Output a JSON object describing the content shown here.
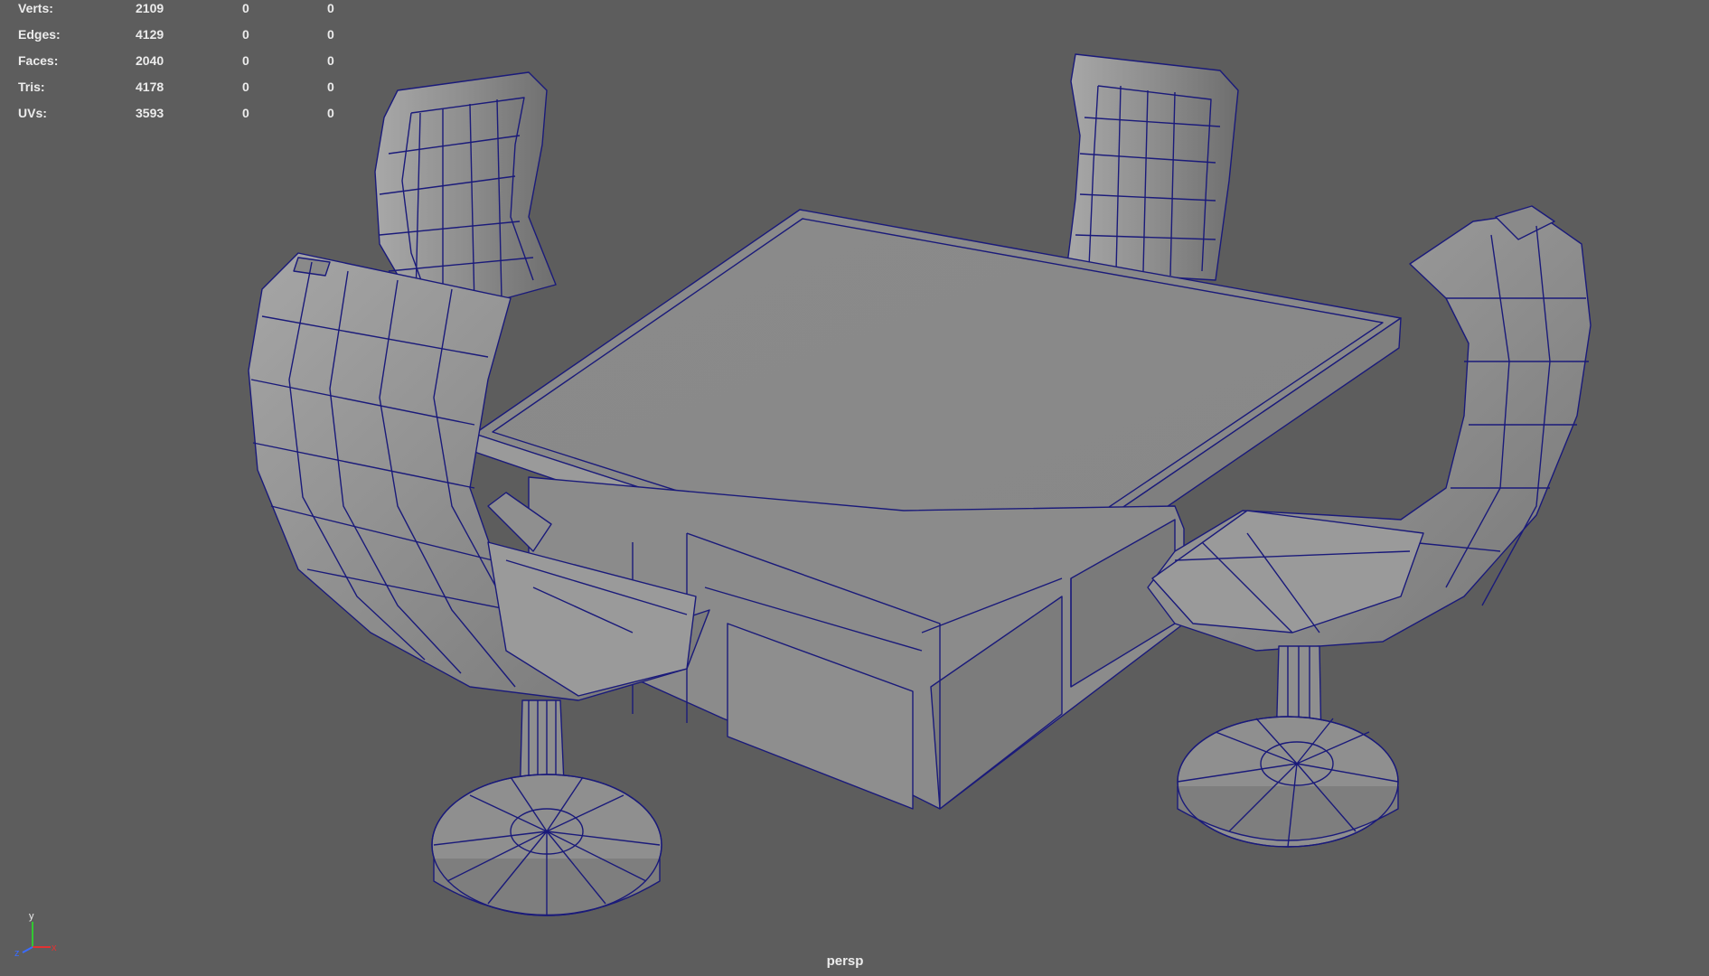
{
  "hud": {
    "rows": [
      {
        "label": "Verts:",
        "v1": "2109",
        "v2": "0",
        "v3": "0"
      },
      {
        "label": "Edges:",
        "v1": "4129",
        "v2": "0",
        "v3": "0"
      },
      {
        "label": "Faces:",
        "v1": "2040",
        "v2": "0",
        "v3": "0"
      },
      {
        "label": "Tris:",
        "v1": "4178",
        "v2": "0",
        "v3": "0"
      },
      {
        "label": "UVs:",
        "v1": "3593",
        "v2": "0",
        "v3": "0"
      }
    ]
  },
  "camera": {
    "name": "persp"
  },
  "axis": {
    "y": "y",
    "z": "z",
    "x": "x"
  },
  "colors": {
    "background": "#5d5d5d",
    "wireframe": "#1a1a7a",
    "surface": "#8c8c8c",
    "axis_x": "#e23232",
    "axis_y": "#32c832",
    "axis_z": "#3a6cff"
  }
}
